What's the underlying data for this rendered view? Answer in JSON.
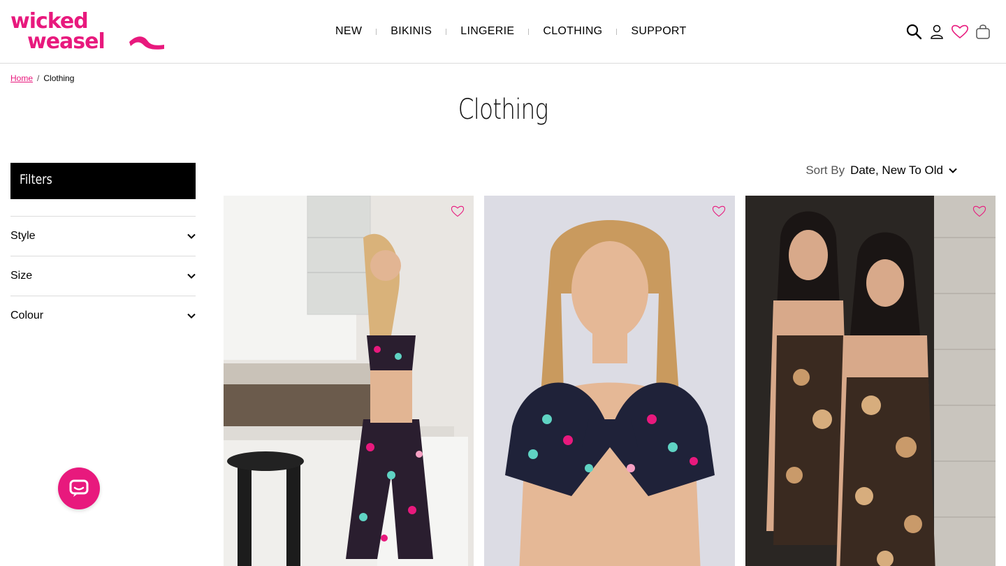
{
  "brand": {
    "name": "wicked weasel",
    "accent": "#e8197d"
  },
  "nav": {
    "items": [
      {
        "label": "NEW"
      },
      {
        "label": "BIKINIS"
      },
      {
        "label": "LINGERIE"
      },
      {
        "label": "CLOTHING"
      },
      {
        "label": "SUPPORT"
      }
    ]
  },
  "header_icons": [
    "search-icon",
    "account-icon",
    "wishlist-heart-icon",
    "cart-bag-icon"
  ],
  "breadcrumb": {
    "home": "Home",
    "separator": "/",
    "current": "Clothing"
  },
  "page": {
    "title": "Clothing"
  },
  "filters": {
    "title": "Filters",
    "groups": [
      {
        "label": "Style"
      },
      {
        "label": "Size"
      },
      {
        "label": "Colour"
      }
    ]
  },
  "sort": {
    "label": "Sort By",
    "value": "Date, New To Old"
  },
  "products": [
    {
      "image": "model-in-leopard-print-crop-top-and-pants-in-kitchen",
      "wishlist_icon": "heart-outline-icon"
    },
    {
      "image": "model-in-leopard-print-tie-front-crop-top",
      "wishlist_icon": "heart-outline-icon"
    },
    {
      "image": "two-models-in-printed-slip-dresses",
      "wishlist_icon": "heart-outline-icon"
    }
  ],
  "chat": {
    "icon": "chat-bubble-icon"
  }
}
